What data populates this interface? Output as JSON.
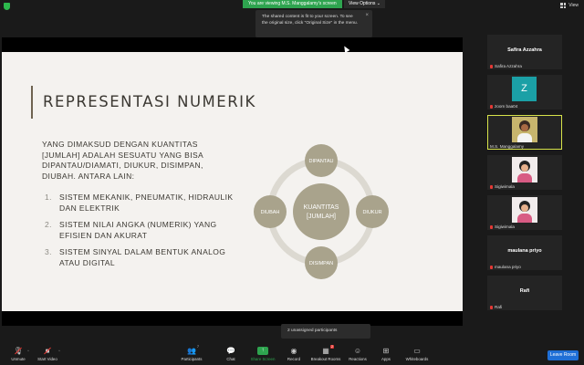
{
  "top": {
    "viewing_text": "You are viewing M.S. Manggalamy's screen",
    "view_options": "View Options ⌄",
    "view_label": "View"
  },
  "tooltip": {
    "text": "The shared content is fit to your screen. To see the original size, click \"Original Size\" in the menu."
  },
  "slide": {
    "title": "REPRESENTASI NUMERIK",
    "intro": "YANG DIMAKSUD DENGAN KUANTITAS [JUMLAH] ADALAH SESUATU YANG BISA DIPANTAU/DIAMATI, DIUKUR, DISIMPAN, DIUBAH. ANTARA LAIN:",
    "items": [
      {
        "num": "1.",
        "text": "SISTEM MEKANIK, PNEUMATIK, HIDRAULIK DAN ELEKTRIK"
      },
      {
        "num": "2.",
        "text": "SISTEM NILAI ANGKA (NUMERIK) YANG EFISIEN DAN AKURAT"
      },
      {
        "num": "3.",
        "text": "SISTEM SINYAL DALAM BENTUK ANALOG ATAU DIGITAL"
      }
    ],
    "diagram": {
      "center_line1": "KUANTITAS",
      "center_line2": "[JUMLAH]",
      "top": "DIPANTAU",
      "right": "DIUKUR",
      "bottom": "DISIMPAN",
      "left": "DIUBAH"
    }
  },
  "participants": [
    {
      "display": "Safira Azzahra",
      "label": "Safira Azzahra",
      "type": "name"
    },
    {
      "display": "Z",
      "label": "zoom baa04",
      "type": "avatar"
    },
    {
      "display": "",
      "label": "M.S. Manggalamy",
      "type": "photo-man",
      "active": true
    },
    {
      "display": "",
      "label": "Sigiwimala",
      "type": "photo-girl"
    },
    {
      "display": "",
      "label": "Sigiwimala",
      "type": "photo-girl"
    },
    {
      "display": "maulana priyo",
      "label": "maulana priyo",
      "type": "name"
    },
    {
      "display": "Rafi",
      "label": "Rafi",
      "type": "name"
    }
  ],
  "popup": {
    "text": "2 unassigned participants"
  },
  "toolbar": {
    "unmute": "Unmute",
    "start_video": "Start Video",
    "participants": "Participants",
    "participants_count": "7",
    "chat": "Chat",
    "share_screen": "Share Screen",
    "record": "Record",
    "breakout": "Breakout Rooms",
    "breakout_badge": "2",
    "reactions": "Reactions",
    "apps": "Apps",
    "whiteboards": "Whiteboards",
    "leave": "Leave Room"
  },
  "colors": {
    "accent_green": "#2ea44f",
    "diagram_circle": "#a9a38c",
    "leave_blue": "#1f6fd6"
  }
}
